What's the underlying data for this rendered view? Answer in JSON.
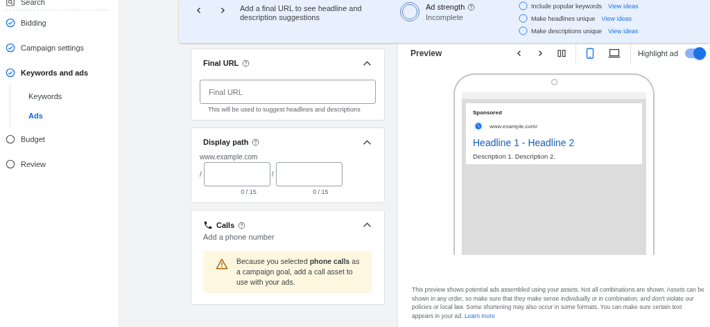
{
  "sidebar": {
    "items": [
      {
        "label": "Search",
        "kind": "search"
      },
      {
        "label": "Bidding",
        "kind": "step",
        "done": true,
        "expanded": false
      },
      {
        "label": "Campaign settings",
        "kind": "step",
        "done": true,
        "expanded": false
      },
      {
        "label": "Keywords and ads",
        "kind": "step",
        "done": true,
        "expanded": true,
        "children": [
          {
            "label": "Keywords",
            "selected": false
          },
          {
            "label": "Ads",
            "selected": true
          }
        ]
      },
      {
        "label": "Budget",
        "kind": "step",
        "done": false,
        "expanded": false
      },
      {
        "label": "Review",
        "kind": "step",
        "done": false,
        "expanded": false
      }
    ]
  },
  "banner": {
    "message": "Add a final URL to see headline and description suggestions",
    "ad_strength": {
      "title": "Ad strength",
      "status": "Incomplete"
    },
    "tips": [
      {
        "label": "Include popular keywords",
        "link": "View ideas",
        "checked": false
      },
      {
        "label": "Make headlines unique",
        "link": "View ideas",
        "checked": false
      },
      {
        "label": "Make descriptions unique",
        "link": "View ideas",
        "checked": false
      }
    ]
  },
  "cards": [
    {
      "kind": "final_url",
      "title": "Final URL",
      "expanded": true,
      "placeholder": "Final URL",
      "hint": "This will be used to suggest headlines and descriptions"
    },
    {
      "kind": "display_path",
      "title": "Display path",
      "expanded": true,
      "domain": "www.example.com",
      "separator": "/",
      "paths": [
        {
          "counter": "0 / 15"
        },
        {
          "counter": "0 / 15"
        }
      ]
    },
    {
      "kind": "calls",
      "title": "Calls",
      "expanded": true,
      "subtitle": "Add a phone number",
      "warning": "Because you selected **phone calls** as a campaign goal, add a call asset to use with your ads."
    }
  ],
  "preview": {
    "title": "Preview",
    "devices": [
      {
        "kind": "mobile",
        "selected": true
      },
      {
        "kind": "desktop",
        "selected": false
      }
    ],
    "highlight_label": "Highlight ad",
    "highlight_on": true,
    "ad": {
      "sponsored": "Sponsored",
      "url": "www.example.com/",
      "headline": "Headline 1 - Headline 2",
      "description": "Description 1. Description 2."
    },
    "note": "This preview shows potential ads assembled using your assets. Not all combinations are shown. Assets can be shown in any order, so make sure that they make sense individually or in combination, and don't violate our policies or local law. Some shortening may also occur in some formats. You can make sure certain text appears in your ad.",
    "note_link": "Learn more"
  }
}
